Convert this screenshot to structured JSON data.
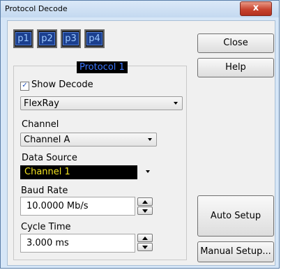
{
  "window": {
    "title": "Protocol Decode",
    "close_glyph": "x"
  },
  "protocol_tabs": [
    "p1",
    "p2",
    "p3",
    "p4"
  ],
  "group": {
    "label": "Protocol 1"
  },
  "show_decode": {
    "label": "Show Decode",
    "checked": true
  },
  "protocol_select": {
    "value": "FlexRay"
  },
  "channel": {
    "label": "Channel",
    "value": "Channel A"
  },
  "data_source": {
    "label": "Data Source",
    "value": "Channel 1"
  },
  "baud_rate": {
    "label": "Baud Rate",
    "value": "10.0000 Mb/s"
  },
  "cycle_time": {
    "label": "Cycle Time",
    "value": "3.000 ms"
  },
  "buttons": {
    "close": "Close",
    "help": "Help",
    "auto_setup": "Auto Setup",
    "manual_setup": "Manual Setup..."
  }
}
